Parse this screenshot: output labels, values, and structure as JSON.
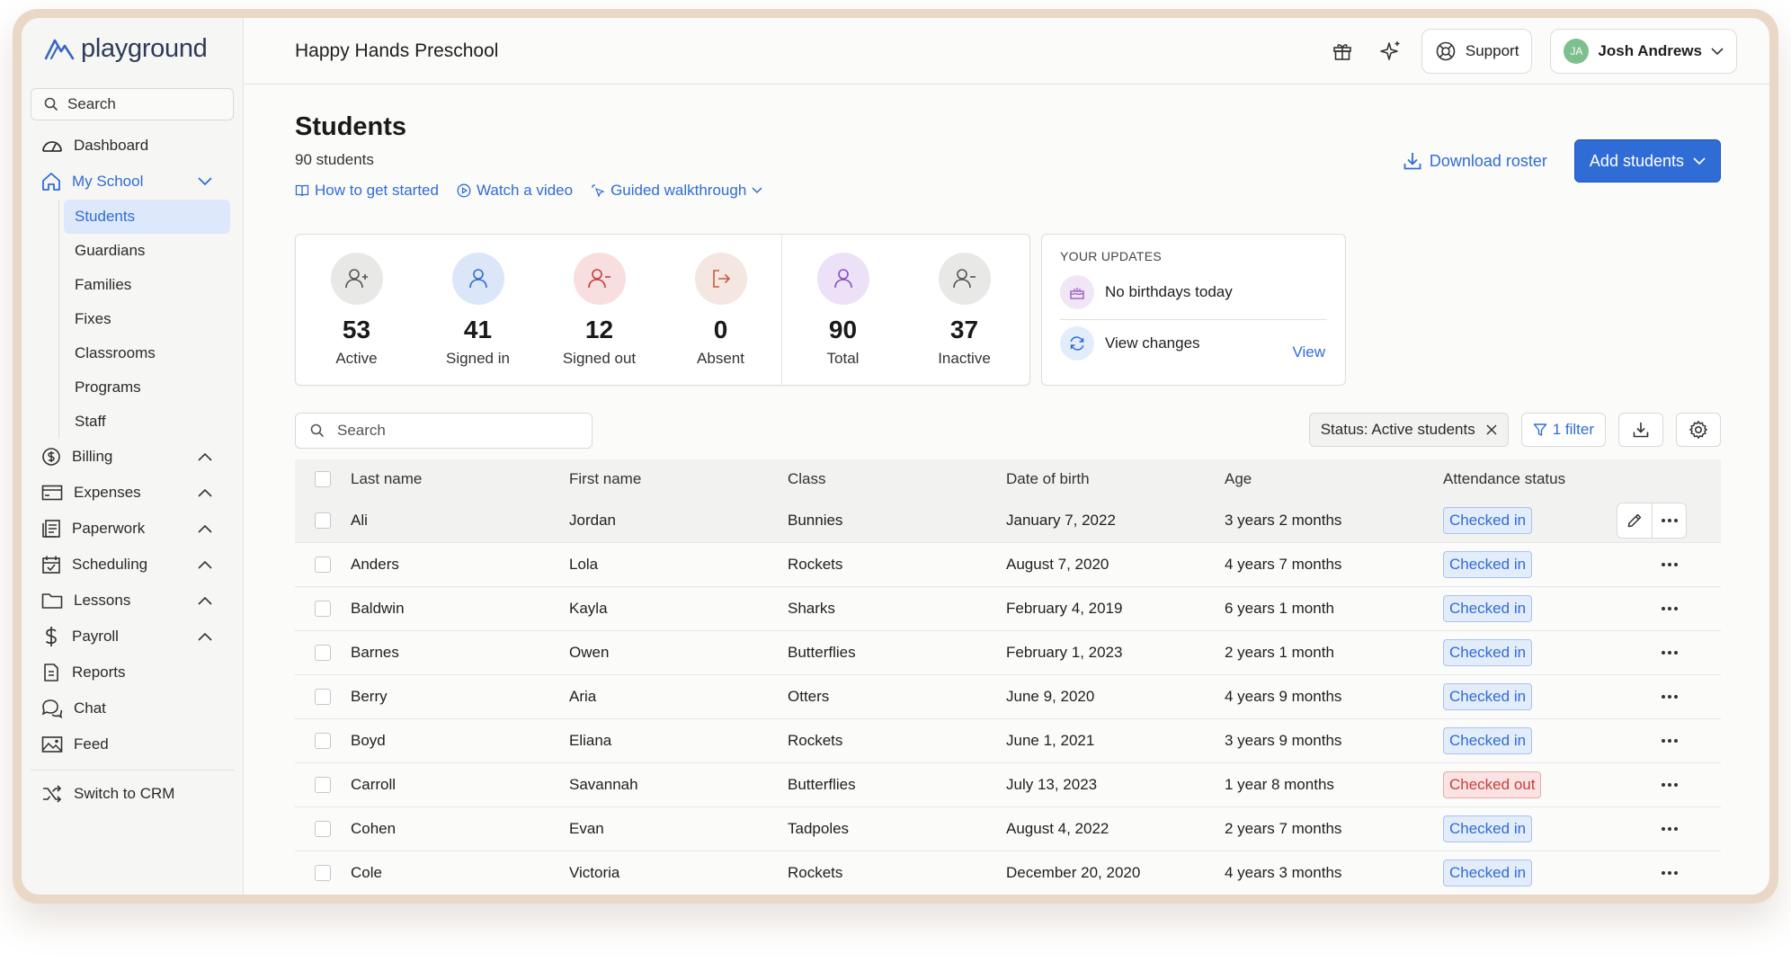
{
  "brand": {
    "name": "playground"
  },
  "sidebar": {
    "search_placeholder": "Search",
    "items": [
      {
        "label": "Dashboard",
        "icon": "dashboard-icon"
      },
      {
        "label": "My School",
        "icon": "home-icon"
      },
      {
        "label": "Billing",
        "icon": "dollar-icon"
      },
      {
        "label": "Expenses",
        "icon": "card-icon"
      },
      {
        "label": "Paperwork",
        "icon": "paperwork-icon"
      },
      {
        "label": "Scheduling",
        "icon": "calendar-icon"
      },
      {
        "label": "Lessons",
        "icon": "folder-icon"
      },
      {
        "label": "Payroll",
        "icon": "dollar-sign-icon"
      },
      {
        "label": "Reports",
        "icon": "reports-icon"
      },
      {
        "label": "Chat",
        "icon": "chat-icon"
      },
      {
        "label": "Feed",
        "icon": "feed-icon"
      }
    ],
    "subitems": [
      "Students",
      "Guardians",
      "Families",
      "Fixes",
      "Classrooms",
      "Programs",
      "Staff"
    ],
    "switch_label": "Switch to CRM"
  },
  "topbar": {
    "school_name": "Happy Hands Preschool",
    "support_label": "Support",
    "user_initials": "JA",
    "user_name": "Josh Andrews"
  },
  "page": {
    "title": "Students",
    "subtitle": "90 students",
    "links": [
      "How to get started",
      "Watch a video",
      "Guided walkthrough"
    ],
    "download_label": "Download roster",
    "add_label": "Add students"
  },
  "stats": [
    {
      "value": "53",
      "label": "Active"
    },
    {
      "value": "41",
      "label": "Signed in"
    },
    {
      "value": "12",
      "label": "Signed out"
    },
    {
      "value": "0",
      "label": "Absent"
    },
    {
      "value": "90",
      "label": "Total"
    },
    {
      "value": "37",
      "label": "Inactive"
    }
  ],
  "updates": {
    "heading": "YOUR UPDATES",
    "birthdays": "No birthdays today",
    "changes": "View changes",
    "view_label": "View"
  },
  "toolbar": {
    "search_placeholder": "Search",
    "status_chip": "Status: Active students",
    "filter_label": "1 filter"
  },
  "table": {
    "columns": [
      "Last name",
      "First name",
      "Class",
      "Date of birth",
      "Age",
      "Attendance status"
    ],
    "rows": [
      {
        "last": "Ali",
        "first": "Jordan",
        "class": "Bunnies",
        "dob": "January 7, 2022",
        "age": "3 years 2 months",
        "status": "Checked in"
      },
      {
        "last": "Anders",
        "first": "Lola",
        "class": "Rockets",
        "dob": "August 7, 2020",
        "age": "4 years 7 months",
        "status": "Checked in"
      },
      {
        "last": "Baldwin",
        "first": "Kayla",
        "class": "Sharks",
        "dob": "February 4, 2019",
        "age": "6 years 1 month",
        "status": "Checked in"
      },
      {
        "last": "Barnes",
        "first": "Owen",
        "class": "Butterflies",
        "dob": "February 1, 2023",
        "age": "2 years 1 month",
        "status": "Checked in"
      },
      {
        "last": "Berry",
        "first": "Aria",
        "class": "Otters",
        "dob": "June 9, 2020",
        "age": "4 years 9 months",
        "status": "Checked in"
      },
      {
        "last": "Boyd",
        "first": "Eliana",
        "class": "Rockets",
        "dob": "June 1, 2021",
        "age": "3 years 9 months",
        "status": "Checked in"
      },
      {
        "last": "Carroll",
        "first": "Savannah",
        "class": "Butterflies",
        "dob": "July 13, 2023",
        "age": "1 year 8 months",
        "status": "Checked out"
      },
      {
        "last": "Cohen",
        "first": "Evan",
        "class": "Tadpoles",
        "dob": "August 4, 2022",
        "age": "2 years 7 months",
        "status": "Checked in"
      },
      {
        "last": "Cole",
        "first": "Victoria",
        "class": "Rockets",
        "dob": "December 20, 2020",
        "age": "4 years 3 months",
        "status": "Checked in"
      }
    ]
  },
  "colors": {
    "accent": "#2f6cd6",
    "checked_in": "#2f6cd6",
    "checked_out": "#c93d3d"
  }
}
